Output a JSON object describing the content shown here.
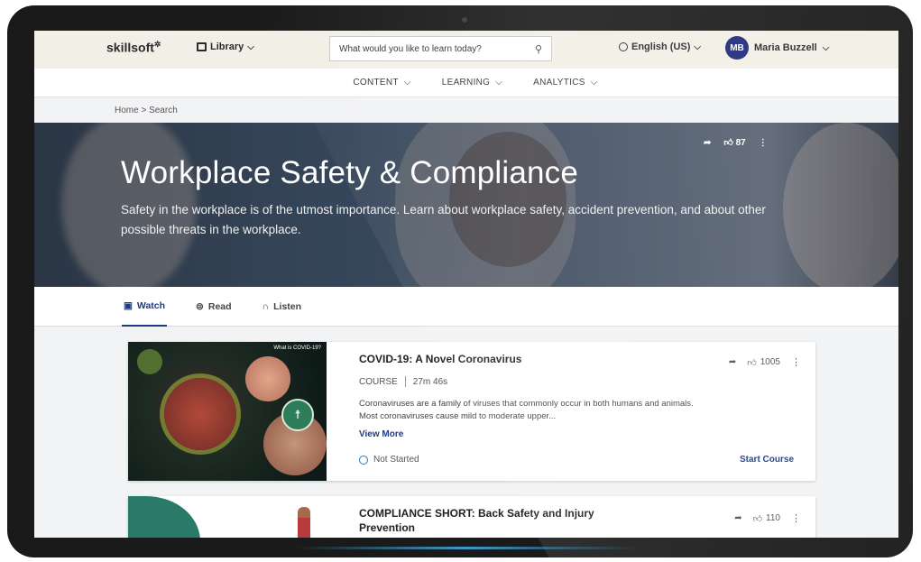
{
  "app": {
    "logo": "skillsoft",
    "library_label": "Library",
    "search_placeholder": "What would you like to learn today?",
    "language": "English (US)",
    "user_initials": "MB",
    "user_name": "Maria Buzzell"
  },
  "nav": {
    "items": [
      {
        "label": "CONTENT"
      },
      {
        "label": "LEARNING"
      },
      {
        "label": "ANALYTICS"
      }
    ]
  },
  "breadcrumb": "Home > Search",
  "hero": {
    "title": "Workplace Safety & Compliance",
    "description": "Safety in the workplace is of the utmost importance. Learn about workplace safety, accident prevention, and about other possible threats in the workplace.",
    "likes": "87"
  },
  "tabs": [
    {
      "label": "Watch",
      "active": true
    },
    {
      "label": "Read",
      "active": false
    },
    {
      "label": "Listen",
      "active": false
    }
  ],
  "courses": [
    {
      "title": "COVID-19: A Novel Coronavirus",
      "type": "COURSE",
      "duration": "27m 46s",
      "description": "Coronaviruses are a family of viruses that commonly occur in both humans and animals. Most coronaviruses cause mild to moderate upper...",
      "view_more": "View More",
      "status": "Not Started",
      "action": "Start Course",
      "likes": "1005",
      "thumb_badge": "What is COVID-19?"
    },
    {
      "title": "COMPLIANCE SHORT: Back Safety and Injury Prevention",
      "likes": "110"
    }
  ],
  "colors": {
    "brand_blue": "#1d3b8a",
    "avatar_bg": "#1d2a7a",
    "topbar_bg": "#f2efe6"
  }
}
